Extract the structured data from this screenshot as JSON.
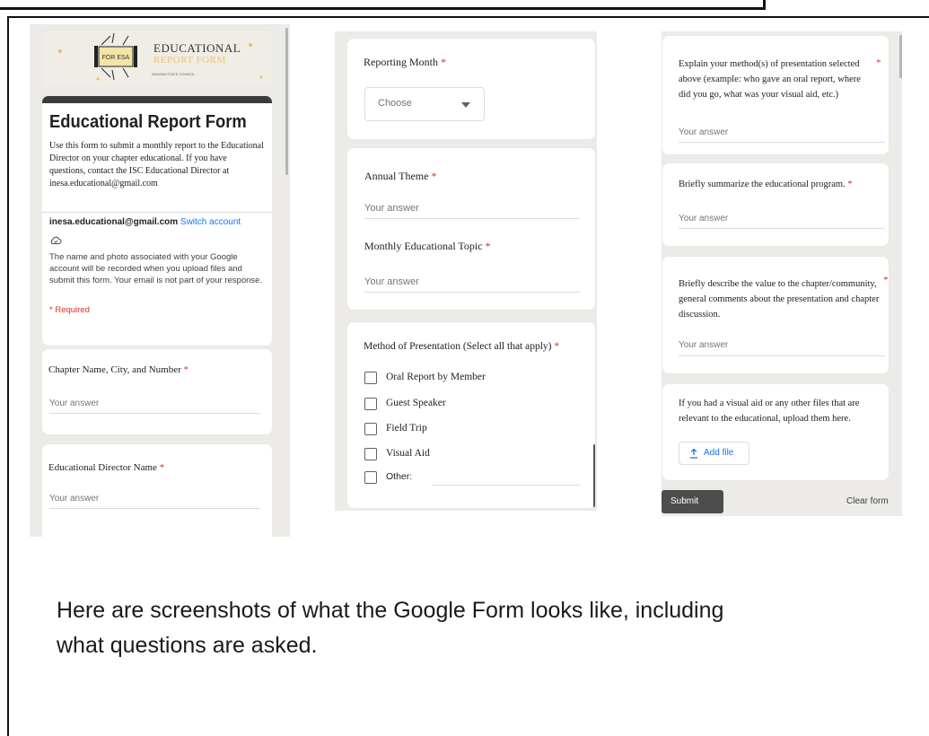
{
  "left": {
    "banner": {
      "line1": "EDUCATIONAL",
      "line2": "REPORT FORM",
      "badge": "FOR ESA",
      "sub": "INDIANA STATE COUNCIL"
    },
    "title": "Educational Report Form",
    "description": "Use this form to submit a monthly report to the Educational Director on your chapter educational. If you have questions, contact the ISC Educational Director at inesa.educational@gmail.com",
    "email": "inesa.educational@gmail.com",
    "switch_account": "Switch account",
    "privacy": "The name and photo associated with your Google account will be recorded when you upload files and submit this form. Your email is not part of your response.",
    "required_note": "* Required",
    "q1": {
      "label": "Chapter Name, City, and Number",
      "star": "*",
      "placeholder": "Your answer"
    },
    "q2": {
      "label": "Educational Director Name",
      "star": "*",
      "placeholder": "Your answer"
    }
  },
  "middle": {
    "q_month": {
      "label": "Reporting Month",
      "star": "*",
      "dropdown": "Choose"
    },
    "q_theme": {
      "label": "Annual Theme",
      "star": "*",
      "placeholder": "Your answer"
    },
    "q_topic": {
      "label": "Monthly Educational Topic",
      "star": "*",
      "placeholder": "Your answer"
    },
    "q_method": {
      "label": "Method of Presentation (Select all that apply)",
      "star": "*",
      "options": [
        "Oral Report by Member",
        "Guest Speaker",
        "Field Trip",
        "Visual Aid",
        "Other:"
      ]
    }
  },
  "right": {
    "q_explain": {
      "label": "Explain your method(s) of presentation selected above (example: who gave an oral report, where did you go, what was your visual aid, etc.)",
      "star": "*",
      "placeholder": "Your answer"
    },
    "q_summary": {
      "label": "Briefly summarize the educational program.",
      "star": "*",
      "placeholder": "Your answer"
    },
    "q_value": {
      "label": "Briefly describe the value to the chapter/community, general comments about the presentation and chapter discussion.",
      "star": "*",
      "placeholder": "Your answer"
    },
    "q_files": {
      "label": "If you had a visual aid or any other files that are relevant to the educational, upload them here.",
      "button": "Add file"
    },
    "submit": "Submit",
    "clear": "Clear form"
  },
  "caption": "Here are screenshots of what the Google Form looks like, including what questions are asked.",
  "colors": {
    "required": "#d93025",
    "link": "#1a73e8",
    "header_bar": "#3c3c3c",
    "submit_bg": "#4d4d4d"
  },
  "icons": [
    "cloud-icon",
    "chevron-down-icon",
    "upload-icon",
    "checkbox-icon"
  ]
}
